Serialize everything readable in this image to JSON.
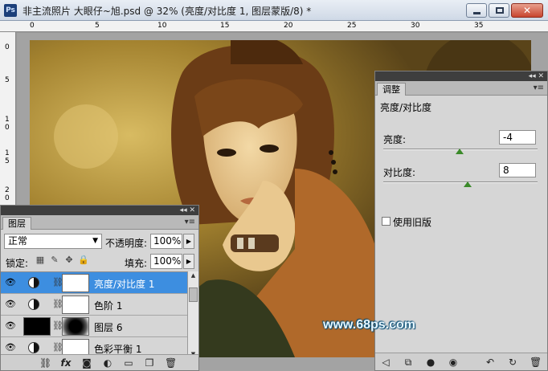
{
  "window": {
    "app_icon": "Ps",
    "title": "非主流照片 大眼仔~旭.psd @ 32% (亮度/对比度 1, 图层蒙版/8) *",
    "close_label": "✕"
  },
  "rulers": {
    "top_labels": [
      "0",
      "5",
      "10",
      "15",
      "20",
      "25",
      "30",
      "35"
    ],
    "left_labels": [
      "0",
      "5",
      "1\n0",
      "1\n5",
      "2\n0"
    ]
  },
  "adjustments": {
    "tab": "调整",
    "title": "亮度/对比度",
    "brightness_label": "亮度:",
    "brightness_value": "-4",
    "contrast_label": "对比度:",
    "contrast_value": "8",
    "legacy_label": "使用旧版"
  },
  "layers": {
    "tab": "图层",
    "blend_mode": "正常",
    "opacity_label": "不透明度:",
    "opacity_value": "100%",
    "lock_label": "锁定:",
    "fill_label": "填充:",
    "fill_value": "100%",
    "items": [
      {
        "name": "亮度/对比度 1",
        "selected": true
      },
      {
        "name": "色阶 1",
        "selected": false
      },
      {
        "name": "图层 6",
        "selected": false
      },
      {
        "name": "色彩平衡 1",
        "selected": false
      }
    ]
  },
  "watermark": "www.68ps.com",
  "colors": {
    "selection": "#3d8ee0",
    "slider_thumb": "#3b8a2a"
  }
}
